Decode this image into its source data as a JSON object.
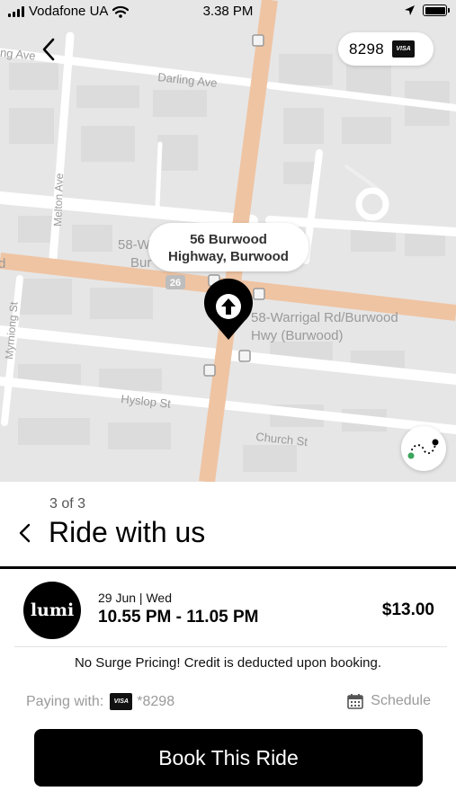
{
  "status_bar": {
    "carrier": "Vodafone UA",
    "time": "3.38 PM",
    "icons": [
      "signal-icon",
      "wifi-icon",
      "location-arrow-icon",
      "battery-icon"
    ]
  },
  "map": {
    "streets": [
      "Darling Ave",
      "Melton Ave",
      "Myrniong St",
      "Hyslop St",
      "Church St"
    ],
    "route_badge": "26",
    "stop_label_1": "58-W",
    "stop_label_1b": "Bur",
    "stop_label_2_line1": "58-Warrigal Rd/Burwood",
    "stop_label_2_line2": "Hwy (Burwood)",
    "cut_label_left": "d",
    "cut_label_top": "ling Ave",
    "pickup_label_line1": "56 Burwood",
    "pickup_label_line2": "Highway, Burwood",
    "icons": [
      "back-icon",
      "visa-icon",
      "pickup-pin-icon",
      "route-icon"
    ]
  },
  "card_chip": {
    "last4": "8298",
    "brand": "VISA"
  },
  "sheet": {
    "step": "3 of 3",
    "title": "Ride with us",
    "ride": {
      "logo_text": "lumi",
      "date": "29 Jun | Wed",
      "time": "10.55 PM - 11.05 PM",
      "price": "$13.00"
    },
    "notice": "No Surge Pricing! Credit is deducted upon booking.",
    "paying_with_label": "Paying with:",
    "paying_card_brand": "VISA",
    "paying_card": "*8298",
    "schedule_label": "Schedule",
    "book_button": "Book This Ride"
  },
  "colors": {
    "map_background": "#e6e6e6",
    "main_road": "#efc4a3",
    "accent": "#000000",
    "muted_text": "#9a9a9a",
    "route_dot_green": "#3aa55c"
  }
}
